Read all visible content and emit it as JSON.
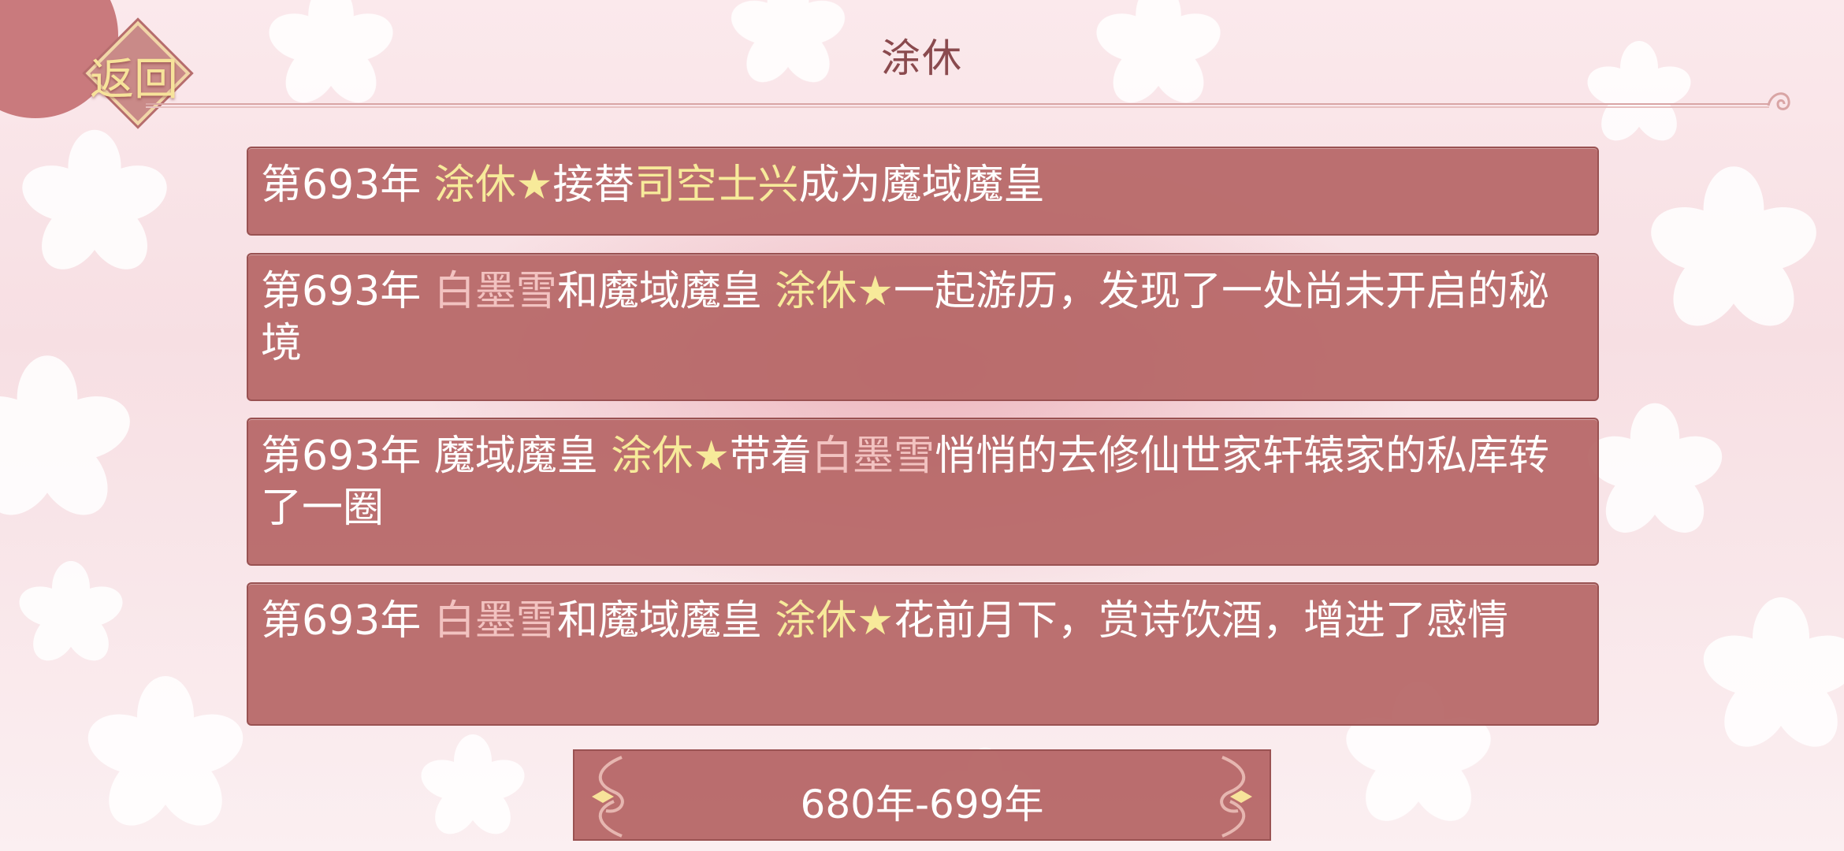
{
  "header": {
    "title": "涂休",
    "back_label": "返回"
  },
  "entries": [
    {
      "segments": [
        {
          "text": "第693年 ",
          "tone": "plain"
        },
        {
          "text": "涂休★",
          "tone": "gold"
        },
        {
          "text": "接替",
          "tone": "plain"
        },
        {
          "text": "司空士兴",
          "tone": "gold"
        },
        {
          "text": "成为魔域魔皇",
          "tone": "plain"
        }
      ]
    },
    {
      "segments": [
        {
          "text": "第693年 ",
          "tone": "plain"
        },
        {
          "text": "白墨雪",
          "tone": "pink"
        },
        {
          "text": "和魔域魔皇 ",
          "tone": "plain"
        },
        {
          "text": "涂休★",
          "tone": "gold"
        },
        {
          "text": "一起游历，发现了一处尚未开启的秘境",
          "tone": "plain"
        }
      ]
    },
    {
      "segments": [
        {
          "text": "第693年 魔域魔皇 ",
          "tone": "plain"
        },
        {
          "text": "涂休★",
          "tone": "gold"
        },
        {
          "text": "带着",
          "tone": "plain"
        },
        {
          "text": "白墨雪",
          "tone": "pink"
        },
        {
          "text": "悄悄的去修仙世家轩辕家的私库转了一圈",
          "tone": "plain"
        }
      ]
    },
    {
      "segments": [
        {
          "text": "第693年 ",
          "tone": "plain"
        },
        {
          "text": "白墨雪",
          "tone": "pink"
        },
        {
          "text": "和魔域魔皇 ",
          "tone": "plain"
        },
        {
          "text": "涂休★",
          "tone": "gold"
        },
        {
          "text": "花前月下，赏诗饮酒，增进了感情",
          "tone": "plain"
        }
      ]
    }
  ],
  "footer": {
    "range_label": "680年-699年",
    "prev_icon": "ornate-left-arrow-icon",
    "next_icon": "ornate-right-arrow-icon"
  },
  "colors": {
    "highlight_gold": "#f7ea9a",
    "highlight_pink": "#f2c2c0",
    "panel": "#b66666"
  }
}
